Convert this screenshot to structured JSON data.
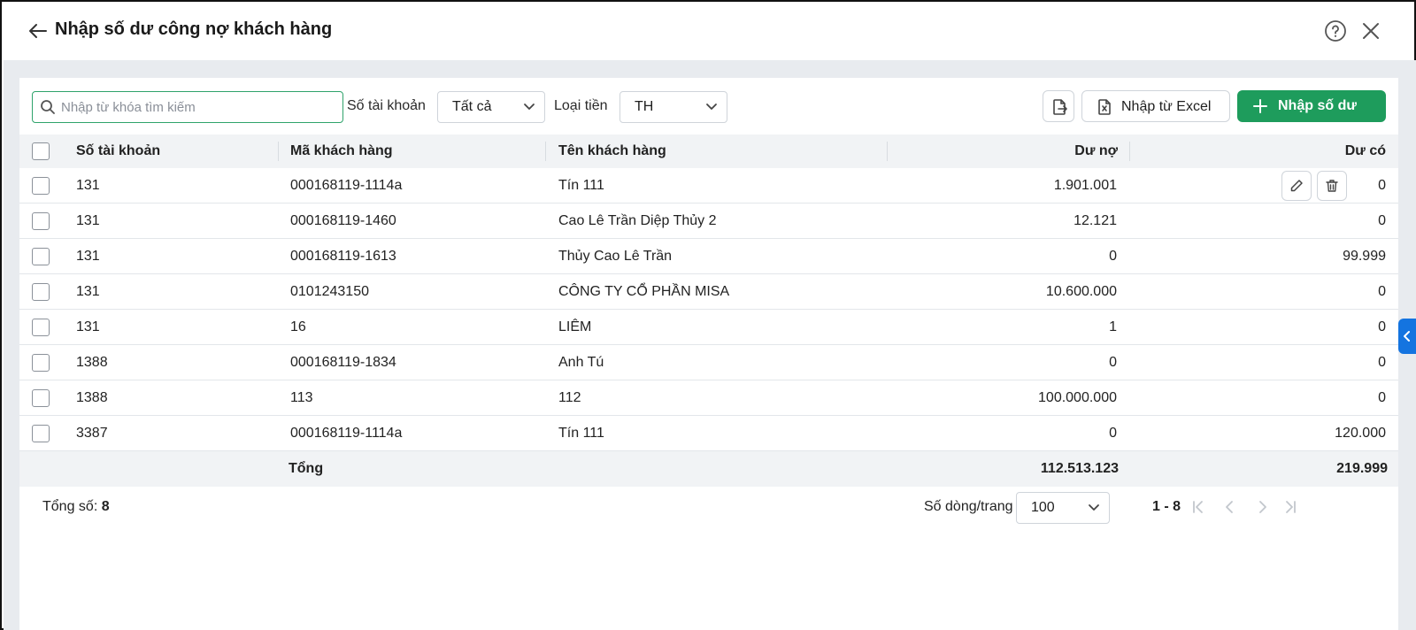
{
  "header": {
    "title": "Nhập số dư công nợ khách hàng"
  },
  "toolbar": {
    "search_placeholder": "Nhập từ khóa tìm kiếm",
    "search_value": "",
    "account_label": "Số tài khoản",
    "account_value": "Tất cả",
    "currency_label": "Loại tiền",
    "currency_value": "TH",
    "import_excel_label": "Nhập từ Excel",
    "add_balance_label": "Nhập số dư"
  },
  "table": {
    "columns": [
      "Số tài khoản",
      "Mã khách hàng",
      "Tên khách hàng",
      "Dư nợ",
      "Dư có"
    ],
    "rows": [
      {
        "account": "131",
        "code": "000168119-1114a",
        "name": "Tín 111",
        "debit": "1.901.001",
        "credit": "0"
      },
      {
        "account": "131",
        "code": "000168119-1460",
        "name": "Cao Lê Trần Diệp Thủy 2",
        "debit": "12.121",
        "credit": "0"
      },
      {
        "account": "131",
        "code": "000168119-1613",
        "name": "Thủy Cao Lê Trần",
        "debit": "0",
        "credit": "99.999"
      },
      {
        "account": "131",
        "code": "0101243150",
        "name": "CÔNG TY CỔ PHẦN MISA",
        "debit": "10.600.000",
        "credit": "0"
      },
      {
        "account": "131",
        "code": "16",
        "name": "LIÊM",
        "debit": "1",
        "credit": "0"
      },
      {
        "account": "1388",
        "code": "000168119-1834",
        "name": "Anh Tú",
        "debit": "0",
        "credit": "0"
      },
      {
        "account": "1388",
        "code": "113",
        "name": "112",
        "debit": "100.000.000",
        "credit": "0"
      },
      {
        "account": "3387",
        "code": "000168119-1114a",
        "name": "Tín 111",
        "debit": "0",
        "credit": "120.000"
      }
    ],
    "footer": {
      "label": "Tổng",
      "debit_total": "112.513.123",
      "credit_total": "219.999"
    }
  },
  "pager": {
    "total_label": "Tổng số:",
    "total_count": "8",
    "rows_per_page_label": "Số dòng/trang",
    "rows_per_page_value": "100",
    "range": "1 - 8"
  },
  "colors": {
    "primary_green": "#1e9c5c",
    "search_border": "#2fa36b",
    "side_tab_blue": "#1474e0",
    "content_bg": "#e8ebef"
  },
  "icons": [
    "arrow-left-icon",
    "help-circle-icon",
    "close-icon",
    "search-icon",
    "chevron-down-icon",
    "export-file-icon",
    "excel-file-icon",
    "plus-icon",
    "pencil-icon",
    "trash-icon",
    "first-page-icon",
    "prev-page-icon",
    "next-page-icon",
    "last-page-icon",
    "chevron-left-icon"
  ]
}
